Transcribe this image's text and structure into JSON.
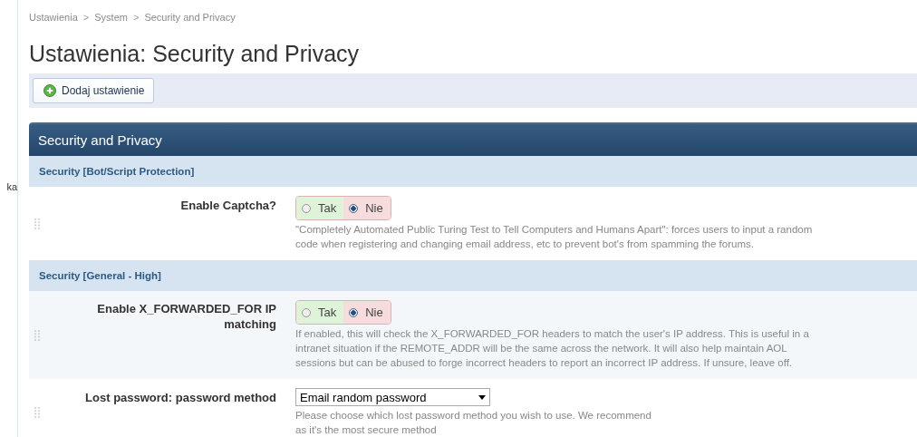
{
  "sidebar": {
    "items": [
      {
        "label": "ka"
      }
    ]
  },
  "breadcrumb": [
    "Ustawienia",
    "System",
    "Security and Privacy"
  ],
  "breadcrumb_separator": ">",
  "title": "Ustawienia: Security and Privacy",
  "toolbar": {
    "button": "Dodaj ustawienie"
  },
  "panel": {
    "title": "Security and Privacy",
    "rows": [
      {
        "kind": "section",
        "label": "Security [Bot/Script Protection]"
      },
      {
        "kind": "toggle",
        "label": "Enable Captcha?",
        "options": [
          {
            "label": "Tak",
            "selected": false
          },
          {
            "label": "Nie",
            "selected": true
          }
        ],
        "description_lines": [
          "\"Completely Automated Public Turing Test to Tell Computers and Humans Apart\": forces users to input a random",
          "code when registering and changing email address, etc to prevent bot's from spamming the forums."
        ]
      },
      {
        "kind": "section",
        "label": "Security [General - High]"
      },
      {
        "kind": "toggle",
        "label": "Enable X_FORWARDED_FOR IP matching",
        "options": [
          {
            "label": "Tak",
            "selected": false
          },
          {
            "label": "Nie",
            "selected": true
          }
        ],
        "description_lines": [
          "If enabled, this will check the X_FORWARDED_FOR headers to match the user's IP address. This is useful in a",
          "intranet situation if the REMOTE_ADDR will be the same across the network. It will also help maintain AOL",
          "sessions but can be abused to forge incorrect headers to report an incorrect IP address. If unsure, leave off."
        ]
      },
      {
        "kind": "select",
        "label": "Lost password: password method",
        "value": "Email random password",
        "description_lines": [
          "Please choose which lost password method you wish to use. We recommend",
          "as it's the most secure method"
        ]
      }
    ]
  }
}
